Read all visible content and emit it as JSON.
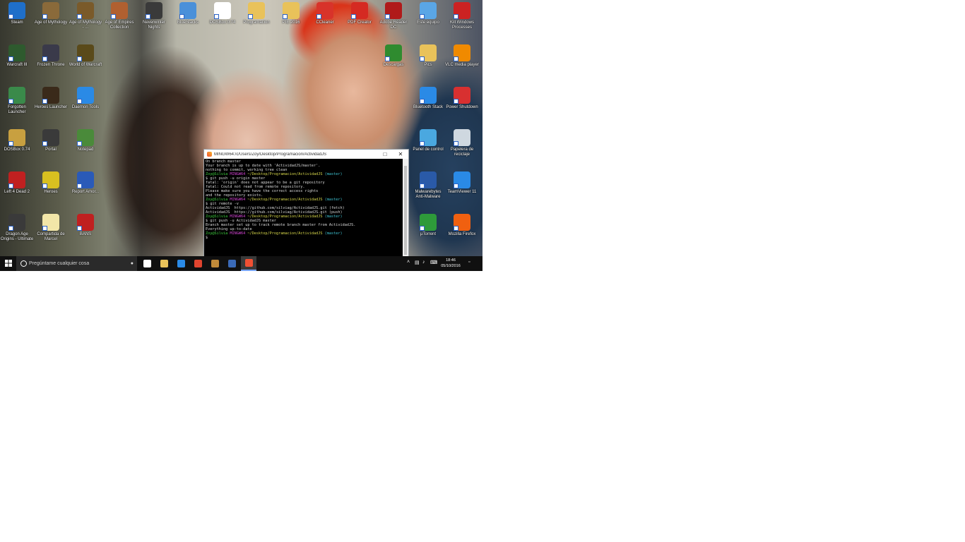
{
  "desktop": {
    "icons": [
      {
        "label": "Steam",
        "icon": "steam-icon",
        "color": "#1f6fc9"
      },
      {
        "label": "Age of Mythology",
        "icon": "age-of-mythology-icon",
        "color": "#8a6a3a"
      },
      {
        "label": "Age of Mythology - ...",
        "icon": "age-of-mythology-titans-icon",
        "color": "#7a5a2a"
      },
      {
        "label": "Age of Empires Collection",
        "icon": "age-of-empires-icon",
        "color": "#b06030"
      },
      {
        "label": "Neverwinter Nights",
        "icon": "neverwinter-icon",
        "color": "#3a3a3a"
      },
      {
        "label": "BlueStacks",
        "icon": "bluestacks-icon",
        "color": "#4a90d9"
      },
      {
        "label": "DOSBox 0.74",
        "icon": "dosbox-doc-icon",
        "color": "#ffffff"
      },
      {
        "label": "Programacion",
        "icon": "folder-icon",
        "color": "#e9c25a"
      },
      {
        "label": "PIE 2016",
        "icon": "folder-icon",
        "color": "#e9c25a"
      },
      {
        "label": "CCleaner",
        "icon": "ccleaner-icon",
        "color": "#d8332a"
      },
      {
        "label": "PDF Creator",
        "icon": "pdfcreator-icon",
        "color": "#d52a22"
      },
      {
        "label": "Adobe Reader DC",
        "icon": "adobe-reader-icon",
        "color": "#b01a1a"
      },
      {
        "label": "Este equipo",
        "icon": "computer-icon",
        "color": "#5aa6e6"
      },
      {
        "label": "Kill Windows Processes",
        "icon": "kill-process-icon",
        "color": "#cc2222"
      },
      {
        "label": "Warcraft III",
        "icon": "warcraft-icon",
        "color": "#2e5a2e"
      },
      {
        "label": "Frozen Throne",
        "icon": "frozen-throne-icon",
        "color": "#3a3a4a"
      },
      {
        "label": "World of Warcraft",
        "icon": "world-of-warcraft-icon",
        "color": "#5a4a1a"
      },
      {
        "label": "Descargas",
        "icon": "downloads-globe-icon",
        "color": "#2f8b2f"
      },
      {
        "label": "Pics",
        "icon": "folder-icon",
        "color": "#e9c25a"
      },
      {
        "label": "VLC media player",
        "icon": "vlc-icon",
        "color": "#f08a00"
      },
      {
        "label": "Forgotten Launcher",
        "icon": "forgotten-launcher-icon",
        "color": "#3a8a4a"
      },
      {
        "label": "Heroes Launcher",
        "icon": "heroes-launcher-icon",
        "color": "#3a2a1a"
      },
      {
        "label": "Daemon Tools",
        "icon": "daemon-tools-icon",
        "color": "#2a8ae6"
      },
      {
        "label": "Bluetooth Stack",
        "icon": "bluetooth-icon",
        "color": "#2a8ae6"
      },
      {
        "label": "Power Shutdown",
        "icon": "power-icon",
        "color": "#d83030"
      },
      {
        "label": "DOSBox 0.74",
        "icon": "dosbox-icon",
        "color": "#c8a040"
      },
      {
        "label": "Portal",
        "icon": "portal-icon",
        "color": "#3a3a3a"
      },
      {
        "label": "Notepad",
        "icon": "notepad-icon",
        "color": "#4a8a3a"
      },
      {
        "label": "Panel de control",
        "icon": "control-panel-icon",
        "color": "#4aa8e0"
      },
      {
        "label": "Papelera de reciclaje",
        "icon": "recycle-bin-icon",
        "color": "#cfd8e0"
      },
      {
        "label": "Left 4 Dead 2",
        "icon": "left4dead-icon",
        "color": "#c02020"
      },
      {
        "label": "Heroes",
        "icon": "heroes-icon",
        "color": "#d8c020"
      },
      {
        "label": "Report Amor...",
        "icon": "word-document-icon",
        "color": "#2a5ab8"
      },
      {
        "label": "Malwarebytes Anti-Malware",
        "icon": "malwarebytes-icon",
        "color": "#2a5aa8"
      },
      {
        "label": "TeamViewer 11",
        "icon": "teamviewer-icon",
        "color": "#2a8ae6"
      },
      {
        "label": "Dragon Age Origins - Ultimate",
        "icon": "dragon-age-icon",
        "color": "#3a3a3a"
      },
      {
        "label": "Compartida de Marcel",
        "icon": "document-icon",
        "color": "#f2e6a8"
      },
      {
        "label": "BANS",
        "icon": "bans-icon",
        "color": "#c02020"
      },
      {
        "label": "µTorrent",
        "icon": "utorrent-icon",
        "color": "#2e9a3a"
      },
      {
        "label": "Mozilla Firefox",
        "icon": "firefox-paw-icon",
        "color": "#f06010"
      }
    ]
  },
  "terminal": {
    "title": "MINGW64:/c/Users/Zoy/Desktop/Programacion/ActividadJS",
    "lines": [
      {
        "text": "On branch master",
        "cls": ""
      },
      {
        "text": "Your branch is up to date with 'ActividadJS/master'.",
        "cls": ""
      },
      {
        "text": "nothing to commit, working tree clean",
        "cls": ""
      },
      {
        "text": "",
        "cls": ""
      },
      {
        "text": "Zoy@Silvia MINGW64 ~/Desktop/Programacion/ActividadJS (master)",
        "cls": "prompt"
      },
      {
        "text": "$ git push -u origin master",
        "cls": ""
      },
      {
        "text": "fatal: 'origin' does not appear to be a git repository",
        "cls": ""
      },
      {
        "text": "fatal: Could not read from remote repository.",
        "cls": ""
      },
      {
        "text": "",
        "cls": ""
      },
      {
        "text": "Please make sure you have the correct access rights",
        "cls": ""
      },
      {
        "text": "and the repository exists.",
        "cls": ""
      },
      {
        "text": "",
        "cls": ""
      },
      {
        "text": "Zoy@Silvia MINGW64 ~/Desktop/Programacion/ActividadJS (master)",
        "cls": "prompt"
      },
      {
        "text": "$ git remote -v",
        "cls": ""
      },
      {
        "text": "ActividadJS  https://github.com/silviag/ActividadJS.git (fetch)",
        "cls": ""
      },
      {
        "text": "ActividadJS  https://github.com/silviag/ActividadJS.git (push)",
        "cls": ""
      },
      {
        "text": "",
        "cls": ""
      },
      {
        "text": "Zoy@Silvia MINGW64 ~/Desktop/Programacion/ActividadJS (master)",
        "cls": "prompt"
      },
      {
        "text": "$ git push -u ActividadJS master",
        "cls": ""
      },
      {
        "text": "Branch master set up to track remote branch master from ActividadJS.",
        "cls": ""
      },
      {
        "text": "Everything up-to-date",
        "cls": ""
      },
      {
        "text": "",
        "cls": ""
      },
      {
        "text": "Zoy@Silvia MINGW64 ~/Desktop/Programacion/ActividadJS (master)",
        "cls": "prompt"
      },
      {
        "text": "$",
        "cls": ""
      }
    ]
  },
  "taskbar": {
    "search_placeholder": "Pregúntame cualquier cosa",
    "items": [
      {
        "name": "task-view-button",
        "color": "#ffffff",
        "active": false
      },
      {
        "name": "file-explorer-button",
        "color": "#e9c25a",
        "active": false
      },
      {
        "name": "store-button",
        "color": "#2a8ae6",
        "active": false
      },
      {
        "name": "chrome-button",
        "color": "#e0442f",
        "active": false
      },
      {
        "name": "media-player-button",
        "color": "#c08a3a",
        "active": false
      },
      {
        "name": "app-button",
        "color": "#3a6ab8",
        "active": false
      },
      {
        "name": "git-bash-button",
        "color": "#f05033",
        "active": true
      }
    ],
    "tray_time": "18:46",
    "tray_date": "05/10/2016"
  }
}
